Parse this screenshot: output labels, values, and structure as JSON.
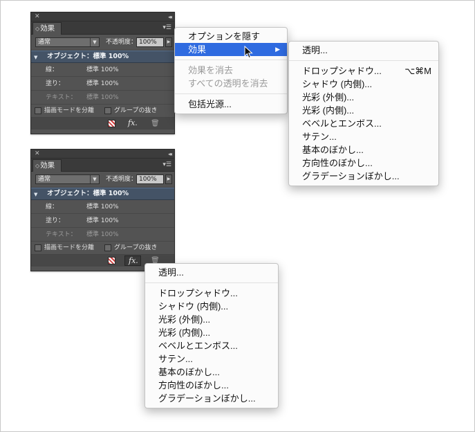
{
  "panel": {
    "tab_label": "効果",
    "blend_mode": "通常",
    "opacity_label": "不透明度：",
    "opacity_value": "100%",
    "object_row": "オブジェクト：標準 100%",
    "rows": [
      {
        "label": "線：",
        "value": "標準 100%",
        "dim": false
      },
      {
        "label": "塗り：",
        "value": "標準 100%",
        "dim": false
      },
      {
        "label": "テキスト：",
        "value": "標準 100%",
        "dim": true
      }
    ],
    "checkboxes": [
      "描画モードを分離",
      "グループの抜き"
    ],
    "fx_label": "fx."
  },
  "panel_menu": {
    "items": [
      {
        "label": "オプションを隠す",
        "state": "normal"
      },
      {
        "label": "効果",
        "state": "active",
        "submenu": true
      },
      {
        "sep": true
      },
      {
        "label": "効果を消去",
        "state": "disabled"
      },
      {
        "label": "すべての透明を消去",
        "state": "disabled"
      },
      {
        "sep": true
      },
      {
        "label": "包括光源...",
        "state": "normal"
      }
    ]
  },
  "effects_menu": {
    "items": [
      {
        "label": "透明..."
      },
      {
        "sep": true
      },
      {
        "label": "ドロップシャドウ...",
        "shortcut": "⌥⌘M"
      },
      {
        "label": "シャドウ (内側)..."
      },
      {
        "label": "光彩 (外側)..."
      },
      {
        "label": "光彩 (内側)..."
      },
      {
        "label": "ベベルとエンボス..."
      },
      {
        "label": "サテン..."
      },
      {
        "label": "基本のぼかし..."
      },
      {
        "label": "方向性のぼかし..."
      },
      {
        "label": "グラデーションぼかし..."
      }
    ]
  },
  "fx_menu": {
    "items": [
      {
        "label": "透明..."
      },
      {
        "sep": true
      },
      {
        "label": "ドロップシャドウ..."
      },
      {
        "label": "シャドウ (内側)..."
      },
      {
        "label": "光彩 (外側)..."
      },
      {
        "label": "光彩 (内側)..."
      },
      {
        "label": "ベベルとエンボス..."
      },
      {
        "label": "サテン..."
      },
      {
        "label": "基本のぼかし..."
      },
      {
        "label": "方向性のぼかし..."
      },
      {
        "label": "グラデーションぼかし..."
      }
    ]
  },
  "icons": {
    "close": "close-icon",
    "collapse": "double-chevron-icon",
    "panel_menu": "panel-menu-icon",
    "trash": "trash-icon",
    "submenu": "submenu-arrow-icon"
  },
  "colors": {
    "menu_highlight": "#2f6be0",
    "panel_bg": "#535353",
    "object_row_bg": "#445366"
  }
}
